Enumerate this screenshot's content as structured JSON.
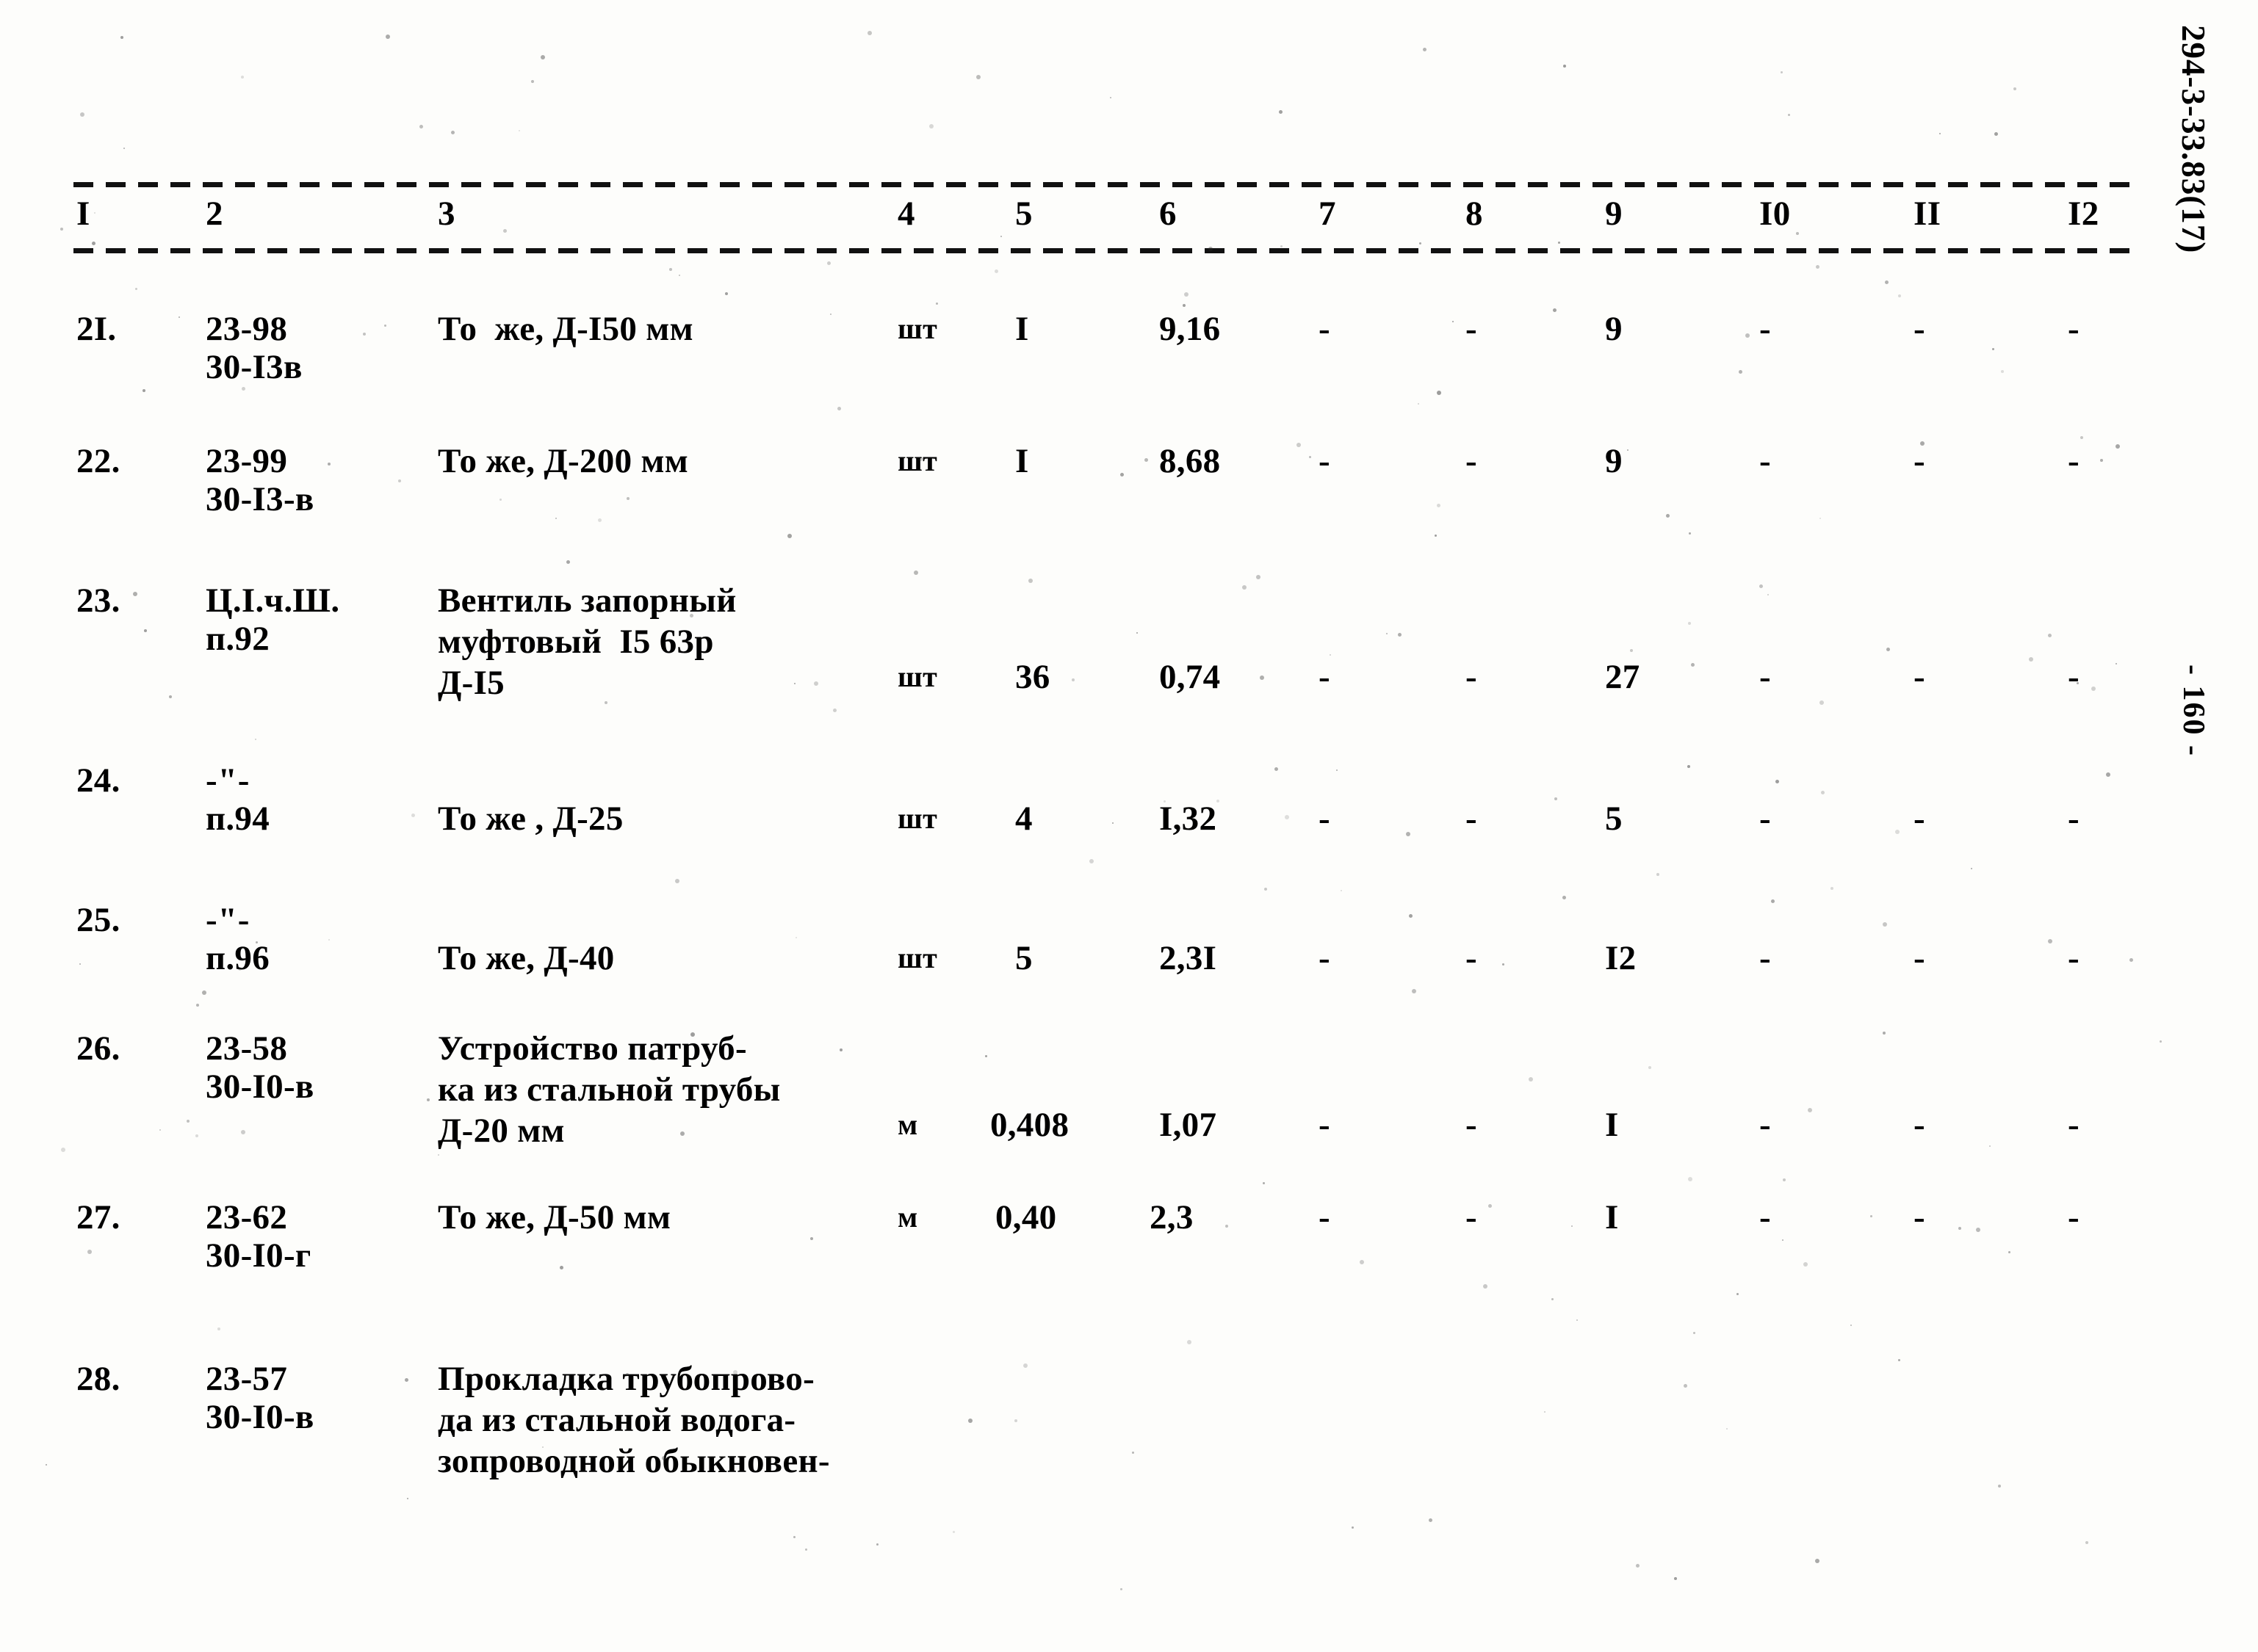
{
  "document": {
    "code_margin": "294-3-33.83(17)",
    "page_marker": "- 160 -"
  },
  "table": {
    "column_headers": [
      "I",
      "2",
      "3",
      "4",
      "5",
      "6",
      "7",
      "8",
      "9",
      "I0",
      "II",
      "I2"
    ],
    "rows": [
      {
        "no": "2I.",
        "code_line1": "23-98",
        "code_line2": "30-I3в",
        "description": "То  же, Д-I50 мм",
        "unit": "шт",
        "c5": "I",
        "c6": "9,16",
        "c7": "-",
        "c8": "-",
        "c9": "9",
        "c10": "-",
        "c11": "-",
        "c12": "-"
      },
      {
        "no": "22.",
        "code_line1": "23-99",
        "code_line2": "30-I3-в",
        "description": "То же, Д-200 мм",
        "unit": "шт",
        "c5": "I",
        "c6": "8,68",
        "c7": "-",
        "c8": "-",
        "c9": "9",
        "c10": "-",
        "c11": "-",
        "c12": "-"
      },
      {
        "no": "23.",
        "code_line1": "Ц.I.ч.Ш.",
        "code_line2": "п.92",
        "description": "Вентиль запорный\nмуфтовый  I5 63р\nД-I5",
        "unit": "шт",
        "c5": "36",
        "c6": "0,74",
        "c7": "-",
        "c8": "-",
        "c9": "27",
        "c10": "-",
        "c11": "-",
        "c12": "-"
      },
      {
        "no": "24.",
        "code_line1": "-\"-",
        "code_line2": "п.94",
        "description": "То же , Д-25",
        "unit": "шт",
        "c5": "4",
        "c6": "I,32",
        "c7": "-",
        "c8": "-",
        "c9": "5",
        "c10": "-",
        "c11": "-",
        "c12": "-"
      },
      {
        "no": "25.",
        "code_line1": "-\"-",
        "code_line2": "п.96",
        "description": "То же, Д-40",
        "unit": "шт",
        "c5": "5",
        "c6": "2,3I",
        "c7": "-",
        "c8": "-",
        "c9": "I2",
        "c10": "-",
        "c11": "-",
        "c12": "-"
      },
      {
        "no": "26.",
        "code_line1": "23-58",
        "code_line2": "30-I0-в",
        "description": "Устройство патруб-\nка из стальной трубы\nД-20 мм",
        "unit": "м",
        "c5": "0,408",
        "c6": "I,07",
        "c7": "-",
        "c8": "-",
        "c9": "I",
        "c10": "-",
        "c11": "-",
        "c12": "-"
      },
      {
        "no": "27.",
        "code_line1": "23-62",
        "code_line2": "30-I0-г",
        "description": "То же, Д-50 мм",
        "unit": "м",
        "c5": "0,40",
        "c6": "2,3",
        "c7": "-",
        "c8": "-",
        "c9": "I",
        "c10": "-",
        "c11": "-",
        "c12": "-"
      },
      {
        "no": "28.",
        "code_line1": "23-57",
        "code_line2": "30-I0-в",
        "description": "Прокладка трубопрово-\nда из стальной водога-\nзопроводной обыкновен-",
        "unit": "",
        "c5": "",
        "c6": "",
        "c7": "",
        "c8": "",
        "c9": "",
        "c10": "",
        "c11": "",
        "c12": ""
      }
    ]
  }
}
